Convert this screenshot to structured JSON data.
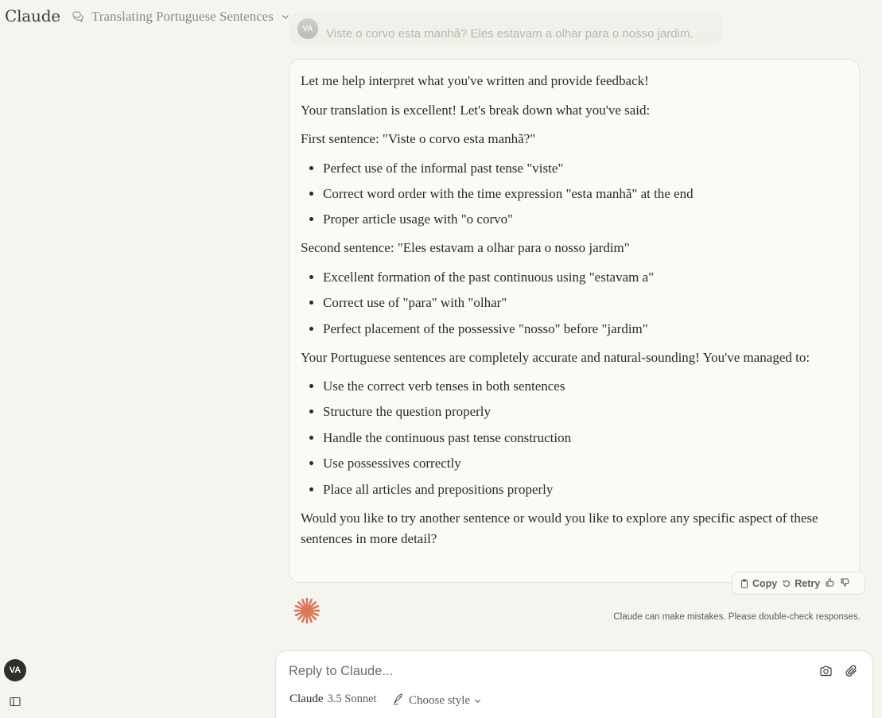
{
  "app": {
    "brand": "Claude"
  },
  "header": {
    "chat_title": "Translating Portuguese Sentences"
  },
  "previous_user_message": {
    "avatar_initials": "VA",
    "text": "Viste o corvo esta manhã? Eles estavam a olhar para o nosso jardim."
  },
  "assistant_message": {
    "intro": "Let me help interpret what you've written and provide feedback!",
    "summary": "Your translation is excellent! Let's break down what you've said:",
    "first_heading": "First sentence: \"Viste o corvo esta manhã?\"",
    "first_points": [
      "Perfect use of the informal past tense \"viste\"",
      "Correct word order with the time expression \"esta manhã\" at the end",
      "Proper article usage with \"o corvo\""
    ],
    "second_heading": "Second sentence: \"Eles estavam a olhar para o nosso jardim\"",
    "second_points": [
      "Excellent formation of the past continuous using \"estavam a\"",
      "Correct use of \"para\" with \"olhar\"",
      "Perfect placement of the possessive \"nosso\" before \"jardim\""
    ],
    "accuracy_note": "Your Portuguese sentences are completely accurate and natural-sounding! You've managed to:",
    "achievements": [
      "Use the correct verb tenses in both sentences",
      "Structure the question properly",
      "Handle the continuous past tense construction",
      "Use possessives correctly",
      "Place all articles and prepositions properly"
    ],
    "closing": "Would you like to try another sentence or would you like to explore any specific aspect of these sentences in more detail?"
  },
  "actions": {
    "copy_label": "Copy",
    "retry_label": "Retry"
  },
  "disclaimer": "Claude can make mistakes. Please double-check responses.",
  "user": {
    "avatar_initials": "VA"
  },
  "composer": {
    "placeholder": "Reply to Claude...",
    "model_name": "Claude",
    "model_version": "3.5 Sonnet",
    "style_label": "Choose style"
  },
  "colors": {
    "accent_spark": "#d97757",
    "background": "#f5f4ef",
    "card": "#fbfaf7"
  }
}
